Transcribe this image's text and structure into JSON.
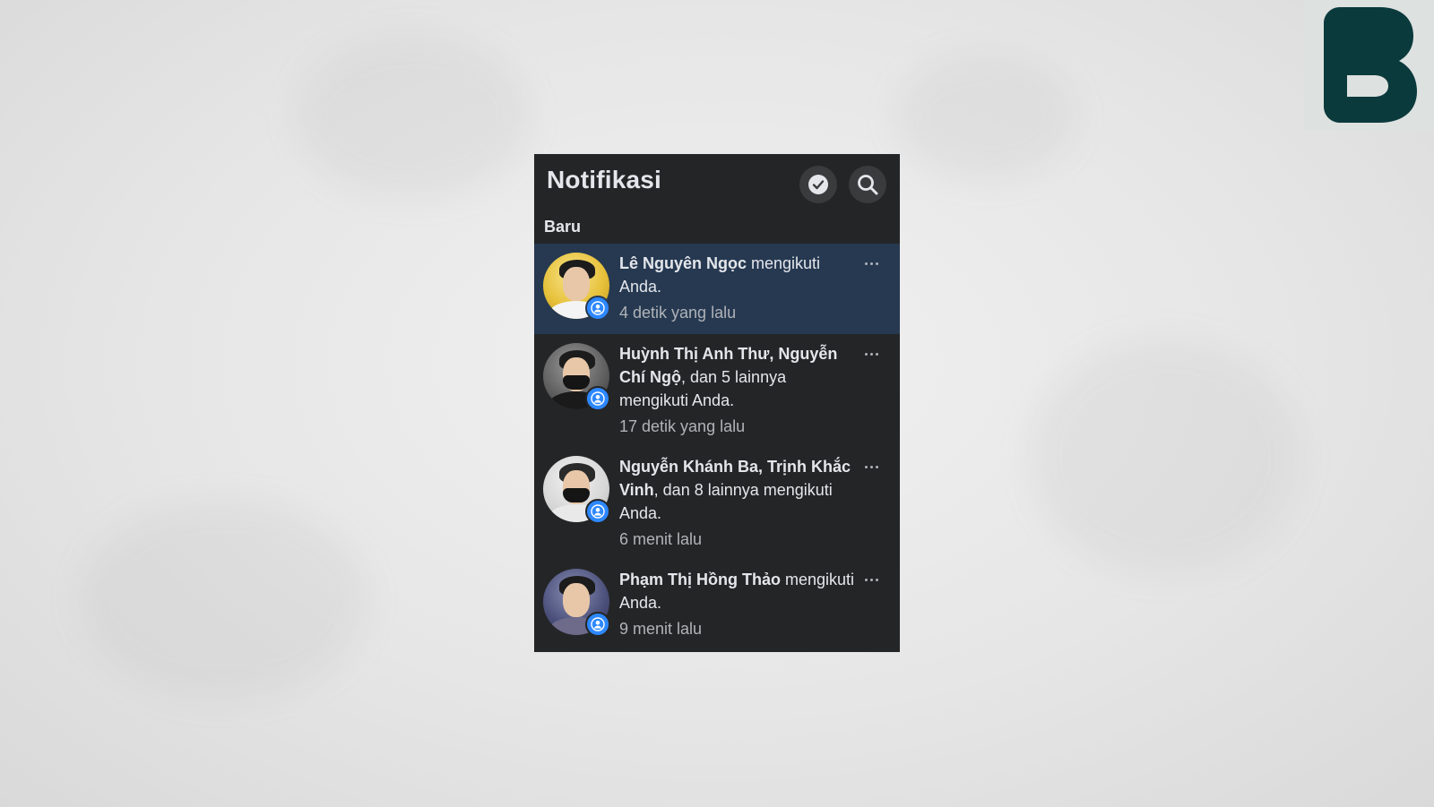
{
  "panel": {
    "title": "Notifikasi",
    "section_label": "Baru"
  },
  "header": {
    "mark_read_icon": "checkmark-circle-icon",
    "search_icon": "search-icon"
  },
  "notifications": [
    {
      "names": "Lê Nguyên Ngọc",
      "text": " mengikuti Anda.",
      "time": "4 detik yang lalu",
      "unread": true
    },
    {
      "names": "Huỳnh Thị Anh Thư, Nguyễn Chí Ngộ",
      "text": ", dan 5 lainnya mengikuti Anda.",
      "time": "17 detik yang lalu",
      "unread": false
    },
    {
      "names": "Nguyễn Khánh Ba, Trịnh Khắc Vinh",
      "text": ", dan 8 lainnya mengikuti Anda.",
      "time": "6 menit lalu",
      "unread": false
    },
    {
      "names": "Phạm Thị Hồng Thảo",
      "text": " mengikuti Anda.",
      "time": "9 menit lalu",
      "unread": false
    }
  ],
  "colors": {
    "panel_bg": "#242526",
    "unread_bg": "#263951",
    "badge_blue": "#2d88ff",
    "text_primary": "#e4e6eb",
    "text_secondary": "#b0b3b8",
    "logo_dark": "#0b3a3d"
  }
}
